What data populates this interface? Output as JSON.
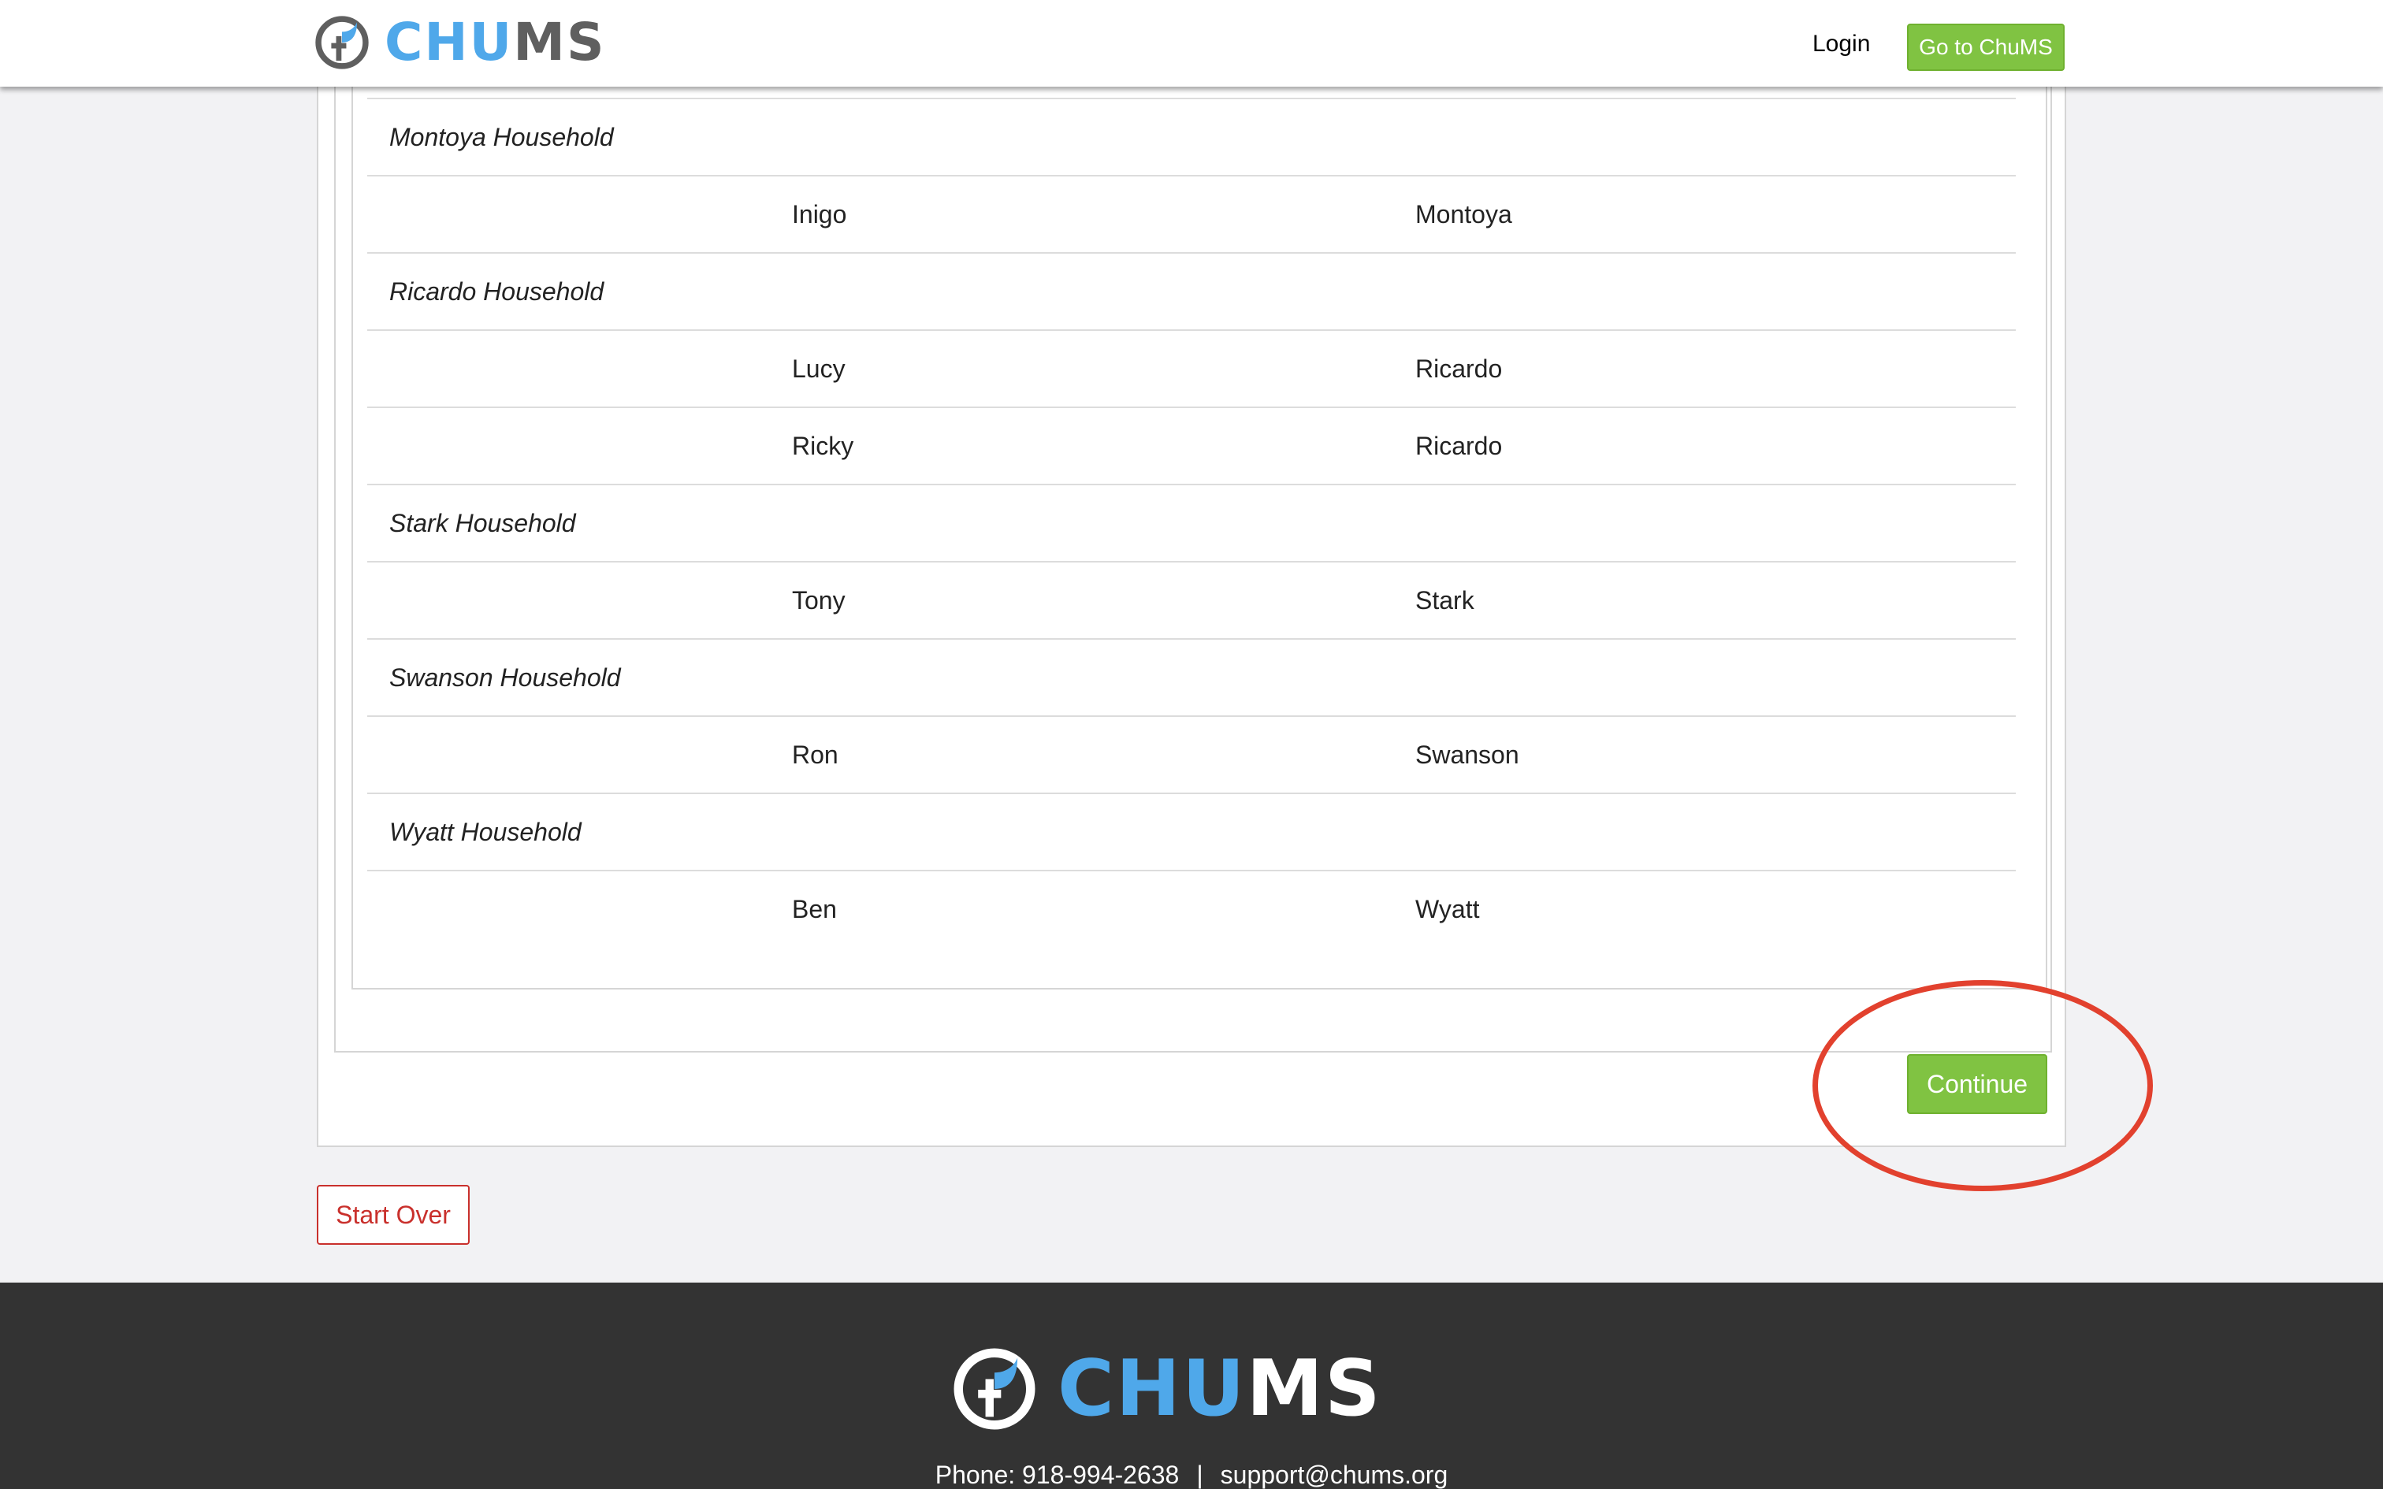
{
  "header": {
    "brand": {
      "part1": "CHU",
      "part2": "MS"
    },
    "login_label": "Login",
    "goto_label": "Go to ChuMS"
  },
  "households": [
    {
      "name": "Montoya Household",
      "members": [
        {
          "first": "Inigo",
          "last": "Montoya"
        }
      ]
    },
    {
      "name": "Ricardo Household",
      "members": [
        {
          "first": "Lucy",
          "last": "Ricardo"
        },
        {
          "first": "Ricky",
          "last": "Ricardo"
        }
      ]
    },
    {
      "name": "Stark Household",
      "members": [
        {
          "first": "Tony",
          "last": "Stark"
        }
      ]
    },
    {
      "name": "Swanson Household",
      "members": [
        {
          "first": "Ron",
          "last": "Swanson"
        }
      ]
    },
    {
      "name": "Wyatt Household",
      "members": [
        {
          "first": "Ben",
          "last": "Wyatt"
        }
      ]
    }
  ],
  "actions": {
    "continue_label": "Continue",
    "start_over_label": "Start Over"
  },
  "footer": {
    "brand": {
      "part1": "CHU",
      "part2": "MS"
    },
    "phone": "Phone: 918-994-2638",
    "separator": "|",
    "email": "support@chums.org"
  },
  "colors": {
    "accent_green": "#80c342",
    "brand_blue": "#4fa8ea",
    "danger_red": "#c9302c",
    "highlight_red": "#e2412e",
    "footer_bg": "#333333"
  }
}
